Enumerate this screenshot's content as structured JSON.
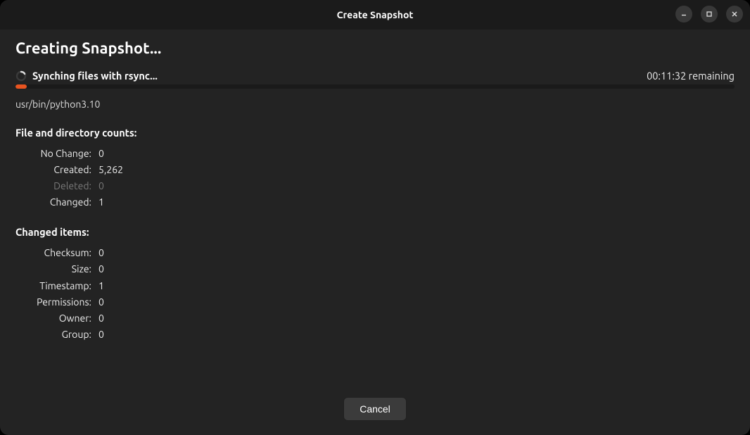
{
  "window": {
    "title": "Create Snapshot"
  },
  "heading": "Creating Snapshot...",
  "status": {
    "text": "Synching files with rsync...",
    "time_remaining": "00:11:32 remaining"
  },
  "progress": {
    "percent": 1.6,
    "color": "#e95420"
  },
  "current_file": "usr/bin/python3.10",
  "file_counts": {
    "section_title": "File and directory counts:",
    "rows": [
      {
        "label": "No Change:",
        "value": "0",
        "disabled": false
      },
      {
        "label": "Created:",
        "value": "5,262",
        "disabled": false
      },
      {
        "label": "Deleted:",
        "value": "0",
        "disabled": true
      },
      {
        "label": "Changed:",
        "value": "1",
        "disabled": false
      }
    ]
  },
  "changed_items": {
    "section_title": "Changed items:",
    "rows": [
      {
        "label": "Checksum:",
        "value": "0"
      },
      {
        "label": "Size:",
        "value": "0"
      },
      {
        "label": "Timestamp:",
        "value": "1"
      },
      {
        "label": "Permissions:",
        "value": "0"
      },
      {
        "label": "Owner:",
        "value": "0"
      },
      {
        "label": "Group:",
        "value": "0"
      }
    ]
  },
  "footer": {
    "cancel_label": "Cancel"
  }
}
